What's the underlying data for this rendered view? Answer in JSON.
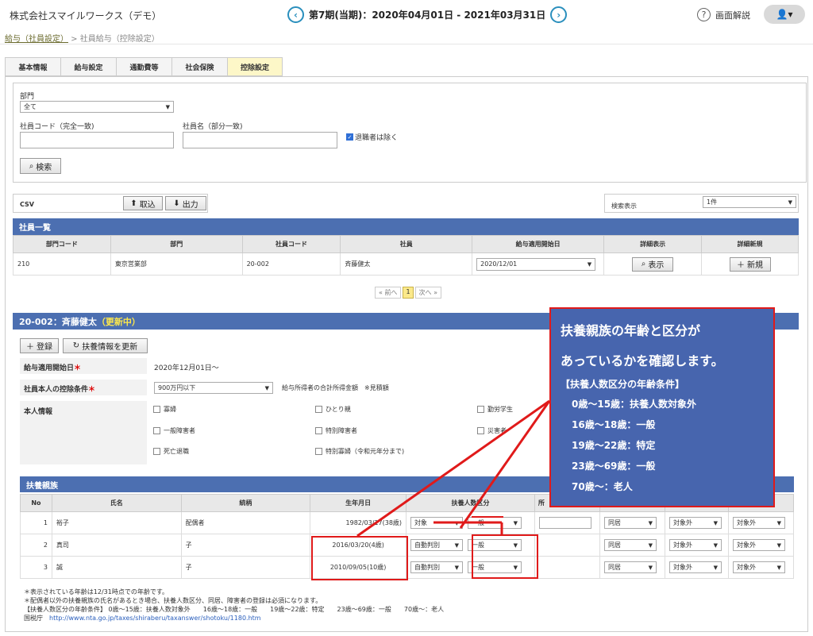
{
  "header": {
    "company": "株式会社スマイルワークス（デモ）",
    "period": "第7期(当期)：2020年04月01日 - 2021年03月31日",
    "prev": "‹",
    "next": "›",
    "help_label": "画面解説",
    "help_icon": "?",
    "user_icon": "👤▾"
  },
  "breadcrumb": {
    "first": "給与（社員設定）",
    "sep": " > ",
    "current": "社員給与（控除設定）"
  },
  "tabs": [
    "基本情報",
    "給与設定",
    "通勤費等",
    "社会保険",
    "控除設定"
  ],
  "search": {
    "dept_label": "部門",
    "dept_value": "全て",
    "code_label": "社員コード（完全一致)",
    "name_label": "社員名（部分一致)",
    "exclude_label": "退職者は除く",
    "search_button": "検索"
  },
  "csv": {
    "label": "CSV",
    "import": "取込",
    "export": "出力",
    "display_label": "検索表示",
    "display_value": "1件"
  },
  "employee_list": {
    "title": "社員一覧",
    "columns": [
      "部門コード",
      "部門",
      "社員コード",
      "社員",
      "給与適用開始日",
      "詳細表示",
      "詳細新規"
    ],
    "row": {
      "dept_code": "210",
      "dept": "東京営業部",
      "emp_code": "20-002",
      "emp": "斉藤健太",
      "start": "2020/12/01",
      "show": "表示",
      "new": "新規"
    }
  },
  "pager": {
    "prev": "« 前へ",
    "page": "1",
    "next": "次へ »"
  },
  "detail": {
    "title": "20-002：斉藤健太",
    "status": "（更新中）",
    "register": "登録",
    "update": "扶養情報を更新",
    "start_label": "給与適用開始日",
    "start_value": "2020年12月01日～",
    "deduct_label": "社員本人の控除条件",
    "deduct_value": "900万円以下",
    "deduct_note": "給与所得者の合計所得金額　※見積額",
    "self_label": "本人情報",
    "checks": [
      "寡婦",
      "ひとり親",
      "勤労学生",
      "一般障害者",
      "特別障害者",
      "災害者",
      "死亡退職",
      "特別寡婦（令和元年分まで)"
    ]
  },
  "dependents": {
    "title": "扶養親族",
    "columns": [
      "No",
      "氏名",
      "続柄",
      "生年月日",
      "扶養人数区分",
      "所"
    ],
    "rows": [
      {
        "no": "1",
        "name": "裕子",
        "rel": "配偶者",
        "dob": "1982/03/17(38歳)",
        "kubun1": "対象",
        "kubun2": "一般",
        "s1": "同居",
        "s2": "対象外",
        "s3": "対象外"
      },
      {
        "no": "2",
        "name": "真司",
        "rel": "子",
        "dob": "2016/03/20(4歳)",
        "kubun1": "自動判別",
        "kubun2": "一般",
        "s1": "同居",
        "s2": "対象外",
        "s3": "対象外"
      },
      {
        "no": "3",
        "name": "誠",
        "rel": "子",
        "dob": "2010/09/05(10歳)",
        "kubun1": "自動判別",
        "kubun2": "一般",
        "s1": "同居",
        "s2": "対象外",
        "s3": "対象外"
      }
    ]
  },
  "callout": {
    "line1": "扶養親族の年齢と区分が",
    "line2": "あっているかを確認します。",
    "head": "【扶養人数区分の年齢条件】",
    "items": [
      "0歳～15歳：扶養人数対象外",
      "16歳～18歳：一般",
      "19歳～22歳：特定",
      "23歳～69歳：一般",
      "70歳～：老人"
    ]
  },
  "notes": {
    "line1": "＊表示されている年齢は12/31時点での年齢です。",
    "line2": "＊配偶者以外の扶養親族の氏名があるとき場合、扶養人数区分、同居、障害者の登録は必須になります。",
    "line3": "【扶養人数区分の年齢条件】 0歳～15歳：扶養人数対象外　　16歳～18歳：一般　　19歳～22歳：特定　　23歳～69歳：一般　　70歳～：老人",
    "line4_label": "国税庁",
    "line4_link": "http://www.nta.go.jp/taxes/shiraberu/taxanswer/shotoku/1180.htm"
  },
  "colors": {
    "accent": "#4c6fb1",
    "callout_border": "#e01a1a",
    "tab_active": "#fdf7c8"
  }
}
